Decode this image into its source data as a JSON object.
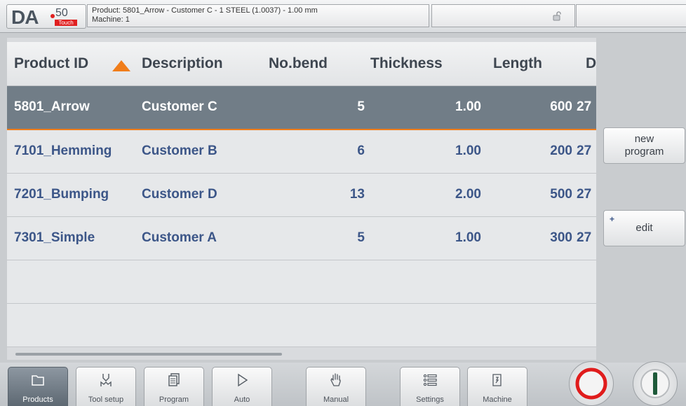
{
  "logo": {
    "brand": "DA",
    "model": "50",
    "badge": "Touch"
  },
  "header": {
    "product_line": "Product: 5801_Arrow - Customer C - 1 STEEL (1.0037) - 1.00 mm",
    "machine_line": "Machine: 1"
  },
  "table": {
    "columns": [
      "Product ID",
      "Description",
      "No.bend",
      "Thickness",
      "Length",
      "Da"
    ],
    "sort_column": "Product ID",
    "sort_direction": "ascending",
    "rows": [
      {
        "id": "5801_Arrow",
        "desc": "Customer C",
        "bends": "5",
        "thickness": "1.00",
        "length": "600",
        "date": "27",
        "selected": true
      },
      {
        "id": "7101_Hemming",
        "desc": "Customer B",
        "bends": "6",
        "thickness": "1.00",
        "length": "200",
        "date": "27",
        "selected": false
      },
      {
        "id": "7201_Bumping",
        "desc": "Customer D",
        "bends": "13",
        "thickness": "2.00",
        "length": "500",
        "date": "27",
        "selected": false
      },
      {
        "id": "7301_Simple",
        "desc": "Customer A",
        "bends": "5",
        "thickness": "1.00",
        "length": "300",
        "date": "27",
        "selected": false
      }
    ]
  },
  "side_buttons": {
    "new_program_1": "new",
    "new_program_2": "program",
    "edit": "edit",
    "edit_marker": "+"
  },
  "nav": [
    "Products",
    "Tool setup",
    "Program",
    "Auto",
    "Manual",
    "Settings",
    "Machine"
  ],
  "colors": {
    "accent": "#f07d1a",
    "selected_row": "#717d87",
    "text_blue": "#3c5688",
    "stop_red": "#e01c1c",
    "start_green": "#1e5a3a"
  }
}
